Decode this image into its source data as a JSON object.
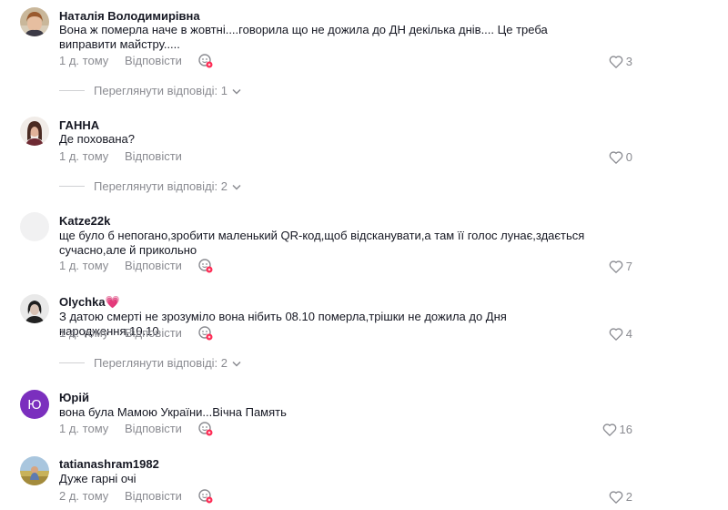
{
  "comments": [
    {
      "username": "Наталія Володимирівна",
      "text": "Вона ж померла наче в жовтні....говорила що не дожила до ДН декілька днів.... Це треба виправити майстру.....",
      "time": "1 д. тому",
      "reply_label": "Відповісти",
      "likes": "3",
      "view_replies": "Переглянути відповіді: 1",
      "avatar_icon": "photo-avatar"
    },
    {
      "username": "ГАННА",
      "text": "Де похована?",
      "time": "1 д. тому",
      "reply_label": "Відповісти",
      "likes": "0",
      "view_replies": "Переглянути відповіді: 2",
      "avatar_icon": "photo-avatar"
    },
    {
      "username": "Katze22k",
      "text": "ще було б непогано,зробити маленький QR-код,щоб відсканувати,а там її голос лунає,здається сучасно,але й прикольно",
      "time": "1 д. тому",
      "reply_label": "Відповісти",
      "likes": "7",
      "avatar_icon": "blank-avatar"
    },
    {
      "username": "Olychka💗",
      "text": "З датою смерті не зрозуміло вона нібить 08.10 померла,трішки не дожила до Дня народження,10.10",
      "time": "1 д. тому",
      "reply_label": "Відповісти",
      "likes": "4",
      "view_replies": "Переглянути відповіді: 2",
      "avatar_icon": "photo-avatar"
    },
    {
      "username": "Юрій",
      "text": "вона була Мамою України...Вічна Память",
      "time": "1 д. тому",
      "reply_label": "Відповісти",
      "likes": "16",
      "avatar_letter": "Ю",
      "avatar_color": "#7b2fbe"
    },
    {
      "username": "tatianashram1982",
      "text": "Дуже гарні очі",
      "time": "2 д. тому",
      "reply_label": "Відповісти",
      "likes": "2",
      "avatar_icon": "photo-avatar"
    }
  ],
  "colors": {
    "text_primary": "#161823",
    "text_secondary": "#8a8b91",
    "sticker_badge": "#fe2c55"
  }
}
